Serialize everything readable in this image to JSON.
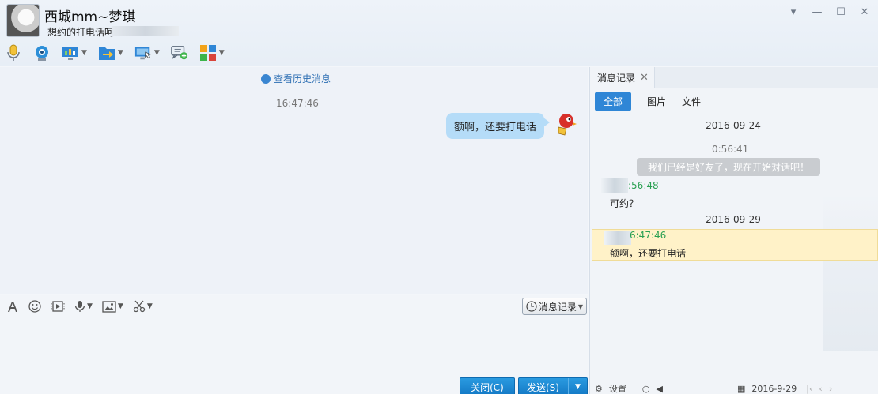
{
  "contact": {
    "name": "西城mm~梦琪",
    "signature": "想约的打电话呵"
  },
  "window_controls": [
    "▾",
    "—",
    "☐",
    "✕"
  ],
  "toolbar": {
    "items": [
      {
        "icon": "microphone-icon"
      },
      {
        "icon": "webcam-icon"
      },
      {
        "icon": "screen-share-icon"
      },
      {
        "icon": "file-transfer-icon"
      },
      {
        "icon": "remote-desktop-icon"
      },
      {
        "icon": "add-chat-icon"
      },
      {
        "icon": "apps-icon"
      }
    ]
  },
  "chat": {
    "history_link": "查看历史消息",
    "time": "16:47:46",
    "messages": [
      {
        "text": "额啊，还要打电话"
      }
    ]
  },
  "input": {
    "history_button": "消息记录",
    "close_button": "关闭(C)",
    "send_button": "发送(S)"
  },
  "side_panel": {
    "tab": "消息记录",
    "filters": [
      "全部",
      "图片",
      "文件"
    ],
    "date1": "2016-09-24",
    "sys_time": "0:56:41",
    "sys_notice": "我们已经是好友了，现在开始对话吧！",
    "rec1_time": ":56:48",
    "rec1_text": "可约？",
    "date2": "2016-09-29",
    "rec2_time": "6:47:46",
    "rec2_text": "额啊，还要打电话",
    "settings": "设置",
    "bottom_date": "2016-9-29"
  },
  "colors": {
    "accent": "#2f86d6",
    "bubble": "#b5dcf8",
    "highlight": "#fff2c8",
    "time_green": "#2aa052"
  }
}
